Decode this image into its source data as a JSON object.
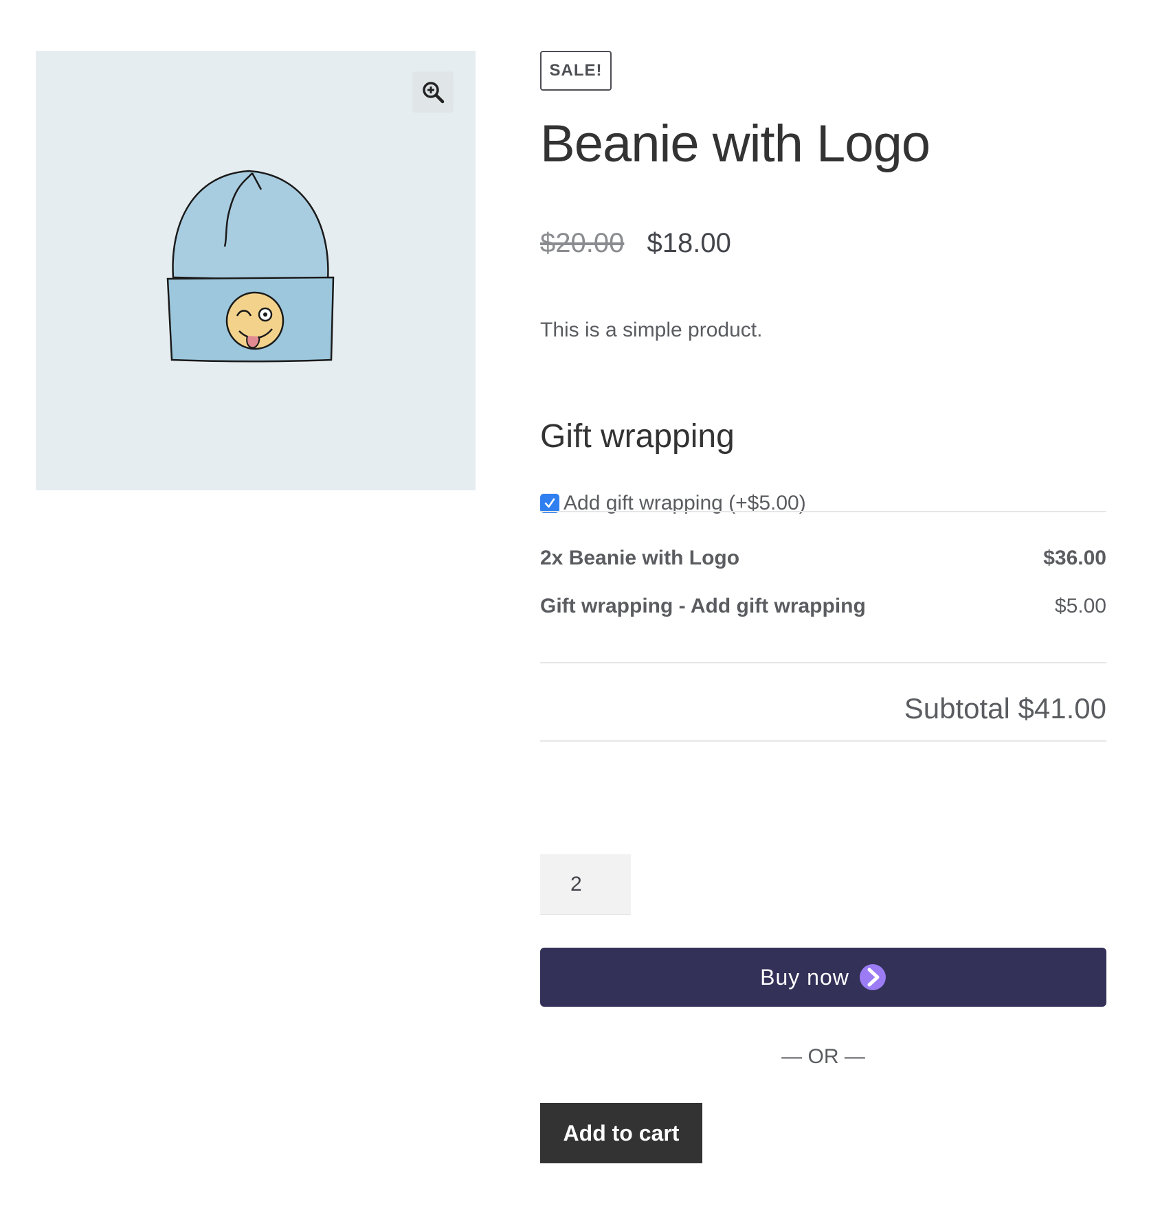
{
  "product": {
    "sale_badge": "SALE!",
    "title": "Beanie with Logo",
    "price_old": "$20.00",
    "price_new": "$18.00",
    "description": "This is a simple product."
  },
  "gift": {
    "heading": "Gift wrapping",
    "option_label": "Add gift wrapping (+$5.00)",
    "checked": true
  },
  "summary_lines": [
    {
      "label": "2x Beanie with Logo",
      "amount": "$36.00"
    },
    {
      "label": "Gift wrapping - Add gift wrapping",
      "amount": "$5.00"
    }
  ],
  "subtotal": "Subtotal $41.00",
  "quantity": "2",
  "buttons": {
    "buy_now": "Buy now",
    "or_separator": "— OR —",
    "add_to_cart": "Add to cart"
  },
  "icons": {
    "zoom": "zoom-in-icon",
    "buy_now_arrow": "chevron-right-icon"
  },
  "colors": {
    "buy_now_bg": "#333158",
    "buy_now_arrow": "#9b7cf4",
    "add_to_cart_bg": "#333333",
    "checkbox": "#2f7ff0",
    "gallery_bg": "#e6edf0"
  }
}
